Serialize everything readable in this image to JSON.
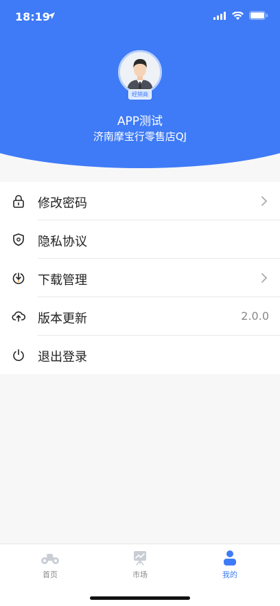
{
  "status_bar": {
    "time": "18:19"
  },
  "profile": {
    "role_badge": "经销商",
    "name": "APP测试",
    "shop": "济南摩宝行零售店QJ"
  },
  "menu": {
    "items": [
      {
        "label": "修改密码",
        "icon": "lock-icon",
        "has_chevron": true
      },
      {
        "label": "隐私协议",
        "icon": "shield-icon",
        "has_chevron": false
      },
      {
        "label": "下载管理",
        "icon": "download-icon",
        "has_chevron": true
      },
      {
        "label": "版本更新",
        "icon": "cloud-upload-icon",
        "value": "2.0.0"
      },
      {
        "label": "退出登录",
        "icon": "power-icon",
        "has_chevron": false
      }
    ]
  },
  "tabbar": {
    "tabs": [
      {
        "label": "首页",
        "icon": "motorcycle-icon",
        "active": false
      },
      {
        "label": "市场",
        "icon": "chart-board-icon",
        "active": false
      },
      {
        "label": "我的",
        "icon": "person-icon",
        "active": true
      }
    ]
  },
  "colors": {
    "accent": "#3f7bf6",
    "background": "#f7f7f8"
  }
}
